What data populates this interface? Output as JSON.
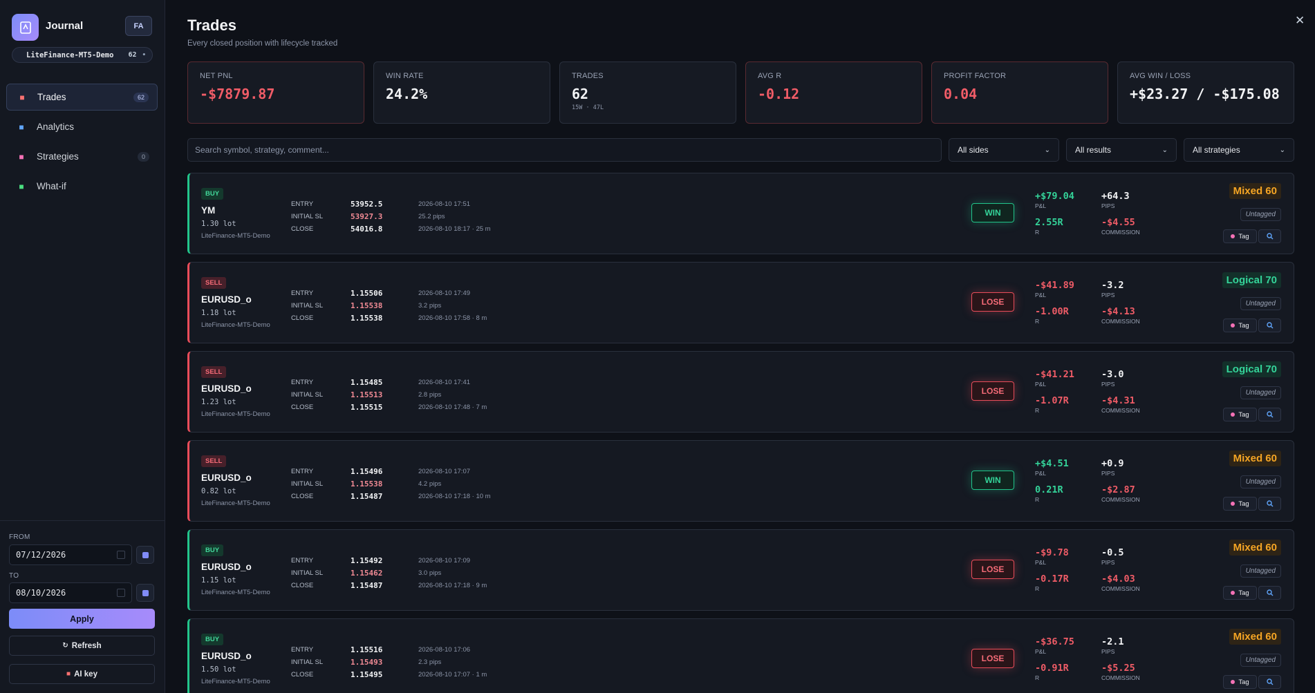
{
  "app": {
    "brand": "Journal",
    "avatar": "FA"
  },
  "account": {
    "name": "LiteFinance-MT5-Demo",
    "count": "62",
    "dot": "•"
  },
  "nav": [
    {
      "label": "Trades",
      "badge": "62",
      "icon": "clipboard-icon",
      "color": "#f87171"
    },
    {
      "label": "Analytics",
      "badge": "",
      "icon": "bar-chart-icon",
      "color": "#60a5fa"
    },
    {
      "label": "Strategies",
      "badge": "0",
      "icon": "target-icon",
      "color": "#f472b6"
    },
    {
      "label": "What-if",
      "badge": "",
      "icon": "pencil-icon",
      "color": "#4ade80"
    }
  ],
  "filters": {
    "from_label": "FROM",
    "from_value": "07/12/2026",
    "to_label": "TO",
    "to_value": "08/10/2026",
    "apply": "Apply",
    "refresh": "Refresh",
    "ai_key": "AI key"
  },
  "page": {
    "title": "Trades",
    "subtitle": "Every closed position with lifecycle tracked",
    "close": "✕"
  },
  "stats": [
    {
      "key": "NET PNL",
      "value": "-$7879.87",
      "negative": true,
      "sub": ""
    },
    {
      "key": "WIN RATE",
      "value": "24.2%",
      "negative": false,
      "sub": ""
    },
    {
      "key": "TRADES",
      "value": "62",
      "negative": false,
      "sub": "15W · 47L"
    },
    {
      "key": "AVG R",
      "value": "-0.12",
      "negative": true,
      "sub": ""
    },
    {
      "key": "PROFIT FACTOR",
      "value": "0.04",
      "negative": true,
      "sub": ""
    },
    {
      "key": "AVG WIN / LOSS",
      "value": "+$23.27 / -$175.08",
      "negative": false,
      "sub": ""
    }
  ],
  "search": {
    "placeholder": "Search symbol, strategy, comment..."
  },
  "selects": {
    "sides": "All sides",
    "results": "All results",
    "strategies": "All strategies"
  },
  "labels": {
    "entry": "ENTRY",
    "initial_sl": "INITIAL SL",
    "close": "CLOSE",
    "pnl": "P&L",
    "pips": "PIPS",
    "r": "R",
    "commission": "COMMISSION",
    "untagged": "Untagged",
    "tag": "Tag"
  },
  "trades": [
    {
      "side": "BUY",
      "symbol": "YM",
      "lot": "1.30 lot",
      "account": "LiteFinance-MT5-Demo",
      "entry": "53952.5",
      "sl": "53927.3",
      "close": "54016.8",
      "entry_time": "2026-08-10 17:51",
      "sl_pips": "25.2 pips",
      "close_time": "2026-08-10 18:17 · 25 m",
      "result": "WIN",
      "pnl": "+$79.04",
      "pips": "+64.3",
      "r": "2.55R",
      "commission": "-$4.55",
      "score": "Mixed 60"
    },
    {
      "side": "SELL",
      "symbol": "EURUSD_o",
      "lot": "1.18 lot",
      "account": "LiteFinance-MT5-Demo",
      "entry": "1.15506",
      "sl": "1.15538",
      "close": "1.15538",
      "entry_time": "2026-08-10 17:49",
      "sl_pips": "3.2 pips",
      "close_time": "2026-08-10 17:58 · 8 m",
      "result": "LOSE",
      "pnl": "-$41.89",
      "pips": "-3.2",
      "r": "-1.00R",
      "commission": "-$4.13",
      "score": "Logical 70"
    },
    {
      "side": "SELL",
      "symbol": "EURUSD_o",
      "lot": "1.23 lot",
      "account": "LiteFinance-MT5-Demo",
      "entry": "1.15485",
      "sl": "1.15513",
      "close": "1.15515",
      "entry_time": "2026-08-10 17:41",
      "sl_pips": "2.8 pips",
      "close_time": "2026-08-10 17:48 · 7 m",
      "result": "LOSE",
      "pnl": "-$41.21",
      "pips": "-3.0",
      "r": "-1.07R",
      "commission": "-$4.31",
      "score": "Logical 70"
    },
    {
      "side": "SELL",
      "symbol": "EURUSD_o",
      "lot": "0.82 lot",
      "account": "LiteFinance-MT5-Demo",
      "entry": "1.15496",
      "sl": "1.15538",
      "close": "1.15487",
      "entry_time": "2026-08-10 17:07",
      "sl_pips": "4.2 pips",
      "close_time": "2026-08-10 17:18 · 10 m",
      "result": "WIN",
      "pnl": "+$4.51",
      "pips": "+0.9",
      "r": "0.21R",
      "commission": "-$2.87",
      "score": "Mixed 60"
    },
    {
      "side": "BUY",
      "symbol": "EURUSD_o",
      "lot": "1.15 lot",
      "account": "LiteFinance-MT5-Demo",
      "entry": "1.15492",
      "sl": "1.15462",
      "close": "1.15487",
      "entry_time": "2026-08-10 17:09",
      "sl_pips": "3.0 pips",
      "close_time": "2026-08-10 17:18 · 9 m",
      "result": "LOSE",
      "pnl": "-$9.78",
      "pips": "-0.5",
      "r": "-0.17R",
      "commission": "-$4.03",
      "score": "Mixed 60"
    },
    {
      "side": "BUY",
      "symbol": "EURUSD_o",
      "lot": "1.50 lot",
      "account": "LiteFinance-MT5-Demo",
      "entry": "1.15516",
      "sl": "1.15493",
      "close": "1.15495",
      "entry_time": "2026-08-10 17:06",
      "sl_pips": "2.3 pips",
      "close_time": "2026-08-10 17:07 · 1 m",
      "result": "LOSE",
      "pnl": "-$36.75",
      "pips": "-2.1",
      "r": "-0.91R",
      "commission": "-$5.25",
      "score": "Mixed 60"
    }
  ]
}
